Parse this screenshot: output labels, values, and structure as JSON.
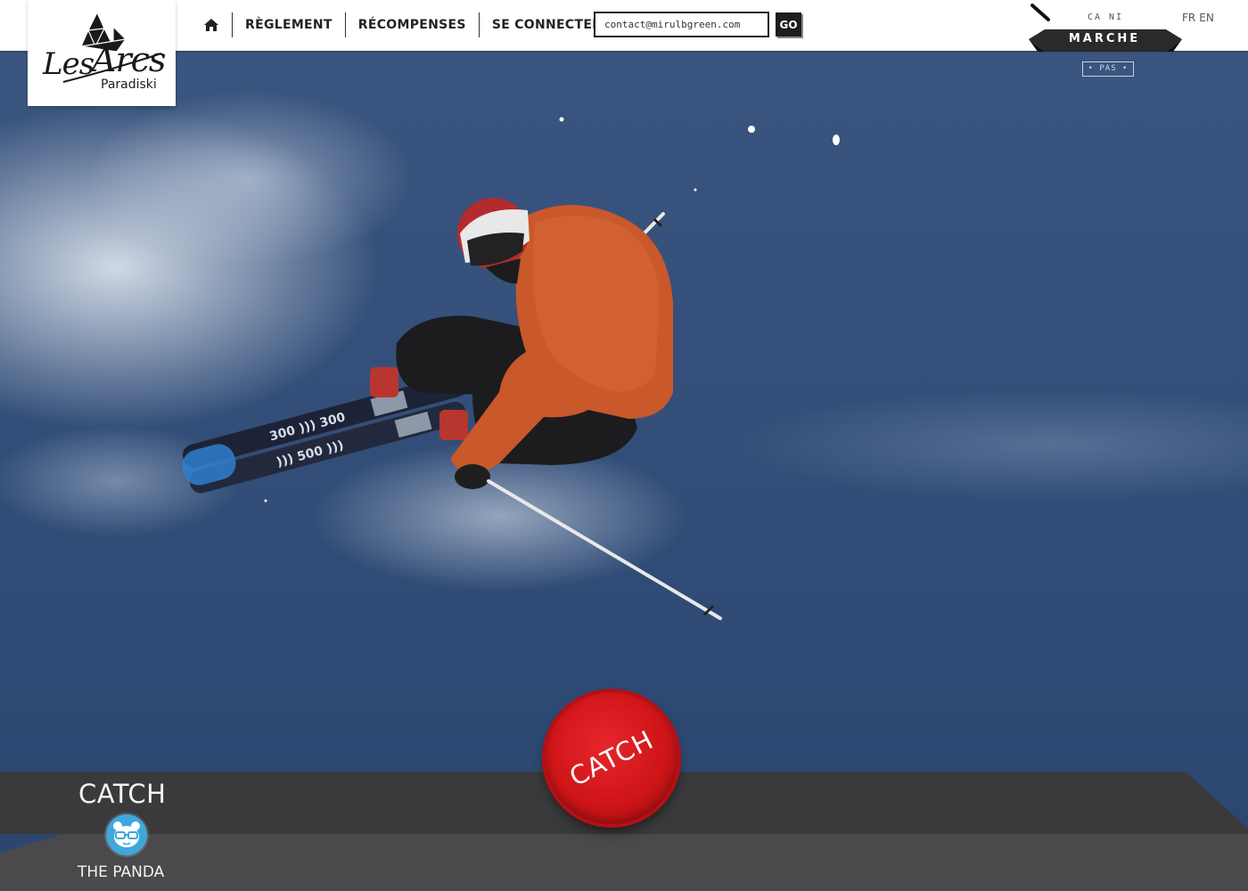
{
  "logo": {
    "word_les": "Les",
    "word_arcs": "Arcs",
    "sub": "Paradiski"
  },
  "nav": {
    "home_icon": "home-icon",
    "items": [
      "RÈGLEMENT",
      "RÉCOMPENSES",
      "SE CONNECTER"
    ]
  },
  "login": {
    "value": "contact@mirulbgreen.com",
    "go_label": "GO"
  },
  "badge": {
    "top": "CA NI",
    "ribbon": "MARCHE",
    "sub": "• PAS •"
  },
  "lang": {
    "fr": "FR",
    "en": "EN"
  },
  "trick": {
    "category": "CATCH",
    "name": "THE PANDA",
    "avatar_icon": "panda-icon"
  },
  "catch_button": {
    "label": "CATCH",
    "color": "#d3171b"
  },
  "colors": {
    "bottom_band": "#3a3a3c",
    "bottom_panel": "#4a4a4c",
    "avatar": "#3fa7dc",
    "jacket": "#c9582a"
  }
}
